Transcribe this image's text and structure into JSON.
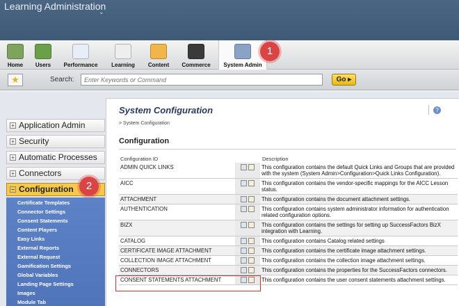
{
  "header": {
    "title": "Learning Administration"
  },
  "nav": [
    {
      "label": "Home",
      "color": "#7da35d"
    },
    {
      "label": "Users",
      "color": "#6aa04a"
    },
    {
      "label": "Performance",
      "color": "#e7eef7"
    },
    {
      "label": "Learning",
      "color": "#eeeeee"
    },
    {
      "label": "Content",
      "color": "#f2b54a"
    },
    {
      "label": "Commerce",
      "color": "#3a3a3a"
    },
    {
      "label": "System Admin",
      "color": "#8aa2c6"
    }
  ],
  "badges": {
    "one": "1",
    "two": "2"
  },
  "search": {
    "label": "Search:",
    "placeholder": "Enter Keywords or Command",
    "go": "Go"
  },
  "sidebar": {
    "items": [
      "Application Admin",
      "Security",
      "Automatic Processes",
      "Connectors",
      "Configuration"
    ],
    "submenu": [
      "Certificate Templates",
      "Connector Settings",
      "Consent Statements",
      "Content Players",
      "Easy Links",
      "External Reports",
      "External Request",
      "Gamification Settings",
      "Global Variables",
      "Landing Page Settings",
      "Images",
      "Module Tab"
    ]
  },
  "main": {
    "title": "System Configuration",
    "breadcrumb": "> System Configuration",
    "section": "Configuration",
    "col_id": "Configuration ID",
    "col_desc": "Description",
    "rows": [
      {
        "id": "ADMIN QUICK LINKS",
        "desc": "This configuration contains the default Quick Links and Groups that are provided with the system (System Admin>Configuration>Quick Links Configuration)."
      },
      {
        "id": "AICC",
        "desc": "This configuration contains the vendor-specific mappings for the AICC Lesson status."
      },
      {
        "id": "ATTACHMENT",
        "desc": "This configuration contains the document attachment settings."
      },
      {
        "id": "AUTHENTICATION",
        "desc": "This configuration contains system administrator information for authentication related configuration options."
      },
      {
        "id": "BIZX",
        "desc": "This configuration contains the settings for setting up SuccessFactors BizX integration with Learning."
      },
      {
        "id": "CATALOG",
        "desc": "This configuration contains Catalog related settings"
      },
      {
        "id": "CERTIFICATE IMAGE ATTACHMENT",
        "desc": "This configuration contains the certificate image attachment settings."
      },
      {
        "id": "COLLECTION IMAGE ATTACHMENT",
        "desc": "This configuration contains the collection image attachment settings."
      },
      {
        "id": "CONNECTORS",
        "desc": "This configuration contains the properties for the SuccessFactors connectors."
      },
      {
        "id": "CONSENT STATEMENTS ATTACHMENT",
        "desc": "This configuration contains the user consent statements attachment settings."
      }
    ]
  }
}
